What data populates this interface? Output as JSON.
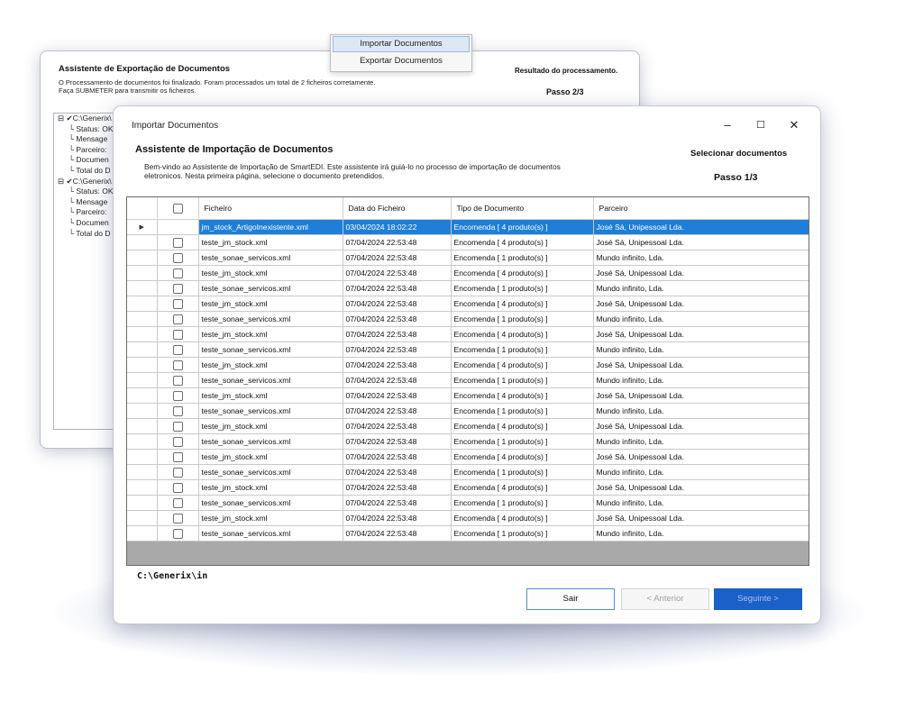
{
  "context_menu": {
    "items": [
      "Importar Documentos",
      "Exportar Documentos"
    ]
  },
  "export_window": {
    "title": "Assistente de Exportação de Documentos",
    "description_line1": "O Processamento de documentos foi finalizado. Foram processados um total de 2 ficheiros corretamente.",
    "description_line2": "Faça SUBMETER para transmitir os ficheiros.",
    "result_label": "Resultado do processamento.",
    "step": "Passo 2/3",
    "tree": [
      {
        "root": "⊟ ✔C:\\Generix\\",
        "children": [
          "Status: OK",
          "Mensage",
          "Parceiro:",
          "Documen",
          "Total do D"
        ]
      },
      {
        "root": "⊟ ✔C:\\Generix\\",
        "children": [
          "Status: OK",
          "Mensage",
          "Parceiro:",
          "Documen",
          "Total do D"
        ]
      }
    ]
  },
  "import_window": {
    "title": "Importar Documentos",
    "controls": {
      "minimize": "–",
      "maximize": "☐",
      "close": "✕"
    },
    "wizard_title": "Assistente de Importação de Documentos",
    "description_line1": "Bem-vindo ao Assistente de Importação de SmartEDI. Este assistente irá guiá-lo no processo de importação de documentos",
    "description_line2": "eletronicos. Nesta primeira página, selecione o documento pretendidos.",
    "step_name": "Selecionar documentos",
    "step": "Passo 1/3",
    "grid": {
      "columns": [
        "Ficheiro",
        "Data do Ficheiro",
        "Tipo de Documento",
        "Parceiro"
      ],
      "selected_index": 0,
      "rows": [
        {
          "file": "jm_stock_ArtigoInexistente.xml",
          "date": "03/04/2024 18:02:22",
          "type": "Encomenda [ 4 produto(s) ]",
          "partner": "José Sá, Unipessoal Lda."
        },
        {
          "file": "teste_jm_stock.xml",
          "date": "07/04/2024 22:53:48",
          "type": "Encomenda [ 4 produto(s) ]",
          "partner": "José Sá, Unipessoal Lda."
        },
        {
          "file": "teste_sonae_servicos.xml",
          "date": "07/04/2024 22:53:48",
          "type": "Encomenda [ 1 produto(s) ]",
          "partner": "Mundo infinito, Lda."
        },
        {
          "file": "teste_jm_stock.xml",
          "date": "07/04/2024 22:53:48",
          "type": "Encomenda [ 4 produto(s) ]",
          "partner": "José Sá, Unipessoal Lda."
        },
        {
          "file": "teste_sonae_servicos.xml",
          "date": "07/04/2024 22:53:48",
          "type": "Encomenda [ 1 produto(s) ]",
          "partner": "Mundo infinito, Lda."
        },
        {
          "file": "teste_jm_stock.xml",
          "date": "07/04/2024 22:53:48",
          "type": "Encomenda [ 4 produto(s) ]",
          "partner": "José Sá, Unipessoal Lda."
        },
        {
          "file": "teste_sonae_servicos.xml",
          "date": "07/04/2024 22:53:48",
          "type": "Encomenda [ 1 produto(s) ]",
          "partner": "Mundo infinito, Lda."
        },
        {
          "file": "teste_jm_stock.xml",
          "date": "07/04/2024 22:53:48",
          "type": "Encomenda [ 4 produto(s) ]",
          "partner": "José Sá, Unipessoal Lda."
        },
        {
          "file": "teste_sonae_servicos.xml",
          "date": "07/04/2024 22:53:48",
          "type": "Encomenda [ 1 produto(s) ]",
          "partner": "Mundo infinito, Lda."
        },
        {
          "file": "teste_jm_stock.xml",
          "date": "07/04/2024 22:53:48",
          "type": "Encomenda [ 4 produto(s) ]",
          "partner": "José Sá, Unipessoal Lda."
        },
        {
          "file": "teste_sonae_servicos.xml",
          "date": "07/04/2024 22:53:48",
          "type": "Encomenda [ 1 produto(s) ]",
          "partner": "Mundo infinito, Lda."
        },
        {
          "file": "teste_jm_stock.xml",
          "date": "07/04/2024 22:53:48",
          "type": "Encomenda [ 4 produto(s) ]",
          "partner": "José Sá, Unipessoal Lda."
        },
        {
          "file": "teste_sonae_servicos.xml",
          "date": "07/04/2024 22:53:48",
          "type": "Encomenda [ 1 produto(s) ]",
          "partner": "Mundo infinito, Lda."
        },
        {
          "file": "teste_jm_stock.xml",
          "date": "07/04/2024 22:53:48",
          "type": "Encomenda [ 4 produto(s) ]",
          "partner": "José Sá, Unipessoal Lda."
        },
        {
          "file": "teste_sonae_servicos.xml",
          "date": "07/04/2024 22:53:48",
          "type": "Encomenda [ 1 produto(s) ]",
          "partner": "Mundo infinito, Lda."
        },
        {
          "file": "teste_jm_stock.xml",
          "date": "07/04/2024 22:53:48",
          "type": "Encomenda [ 4 produto(s) ]",
          "partner": "José Sá, Unipessoal Lda."
        },
        {
          "file": "teste_sonae_servicos.xml",
          "date": "07/04/2024 22:53:48",
          "type": "Encomenda [ 1 produto(s) ]",
          "partner": "Mundo infinito, Lda."
        },
        {
          "file": "teste_jm_stock.xml",
          "date": "07/04/2024 22:53:48",
          "type": "Encomenda [ 4 produto(s) ]",
          "partner": "José Sá, Unipessoal Lda."
        },
        {
          "file": "teste_sonae_servicos.xml",
          "date": "07/04/2024 22:53:48",
          "type": "Encomenda [ 1 produto(s) ]",
          "partner": "Mundo infinito, Lda."
        },
        {
          "file": "teste_jm_stock.xml",
          "date": "07/04/2024 22:53:48",
          "type": "Encomenda [ 4 produto(s) ]",
          "partner": "José Sá, Unipessoal Lda."
        },
        {
          "file": "teste_sonae_servicos.xml",
          "date": "07/04/2024 22:53:48",
          "type": "Encomenda [ 1 produto(s) ]",
          "partner": "Mundo infinito, Lda."
        }
      ]
    },
    "path": "C:\\Generix\\in",
    "buttons": {
      "exit": "Sair",
      "previous": "< Anterior",
      "next": "Seguinte >"
    },
    "colors": {
      "selection": "#1f7fd8",
      "primary_button": "#1b5fc9"
    }
  }
}
